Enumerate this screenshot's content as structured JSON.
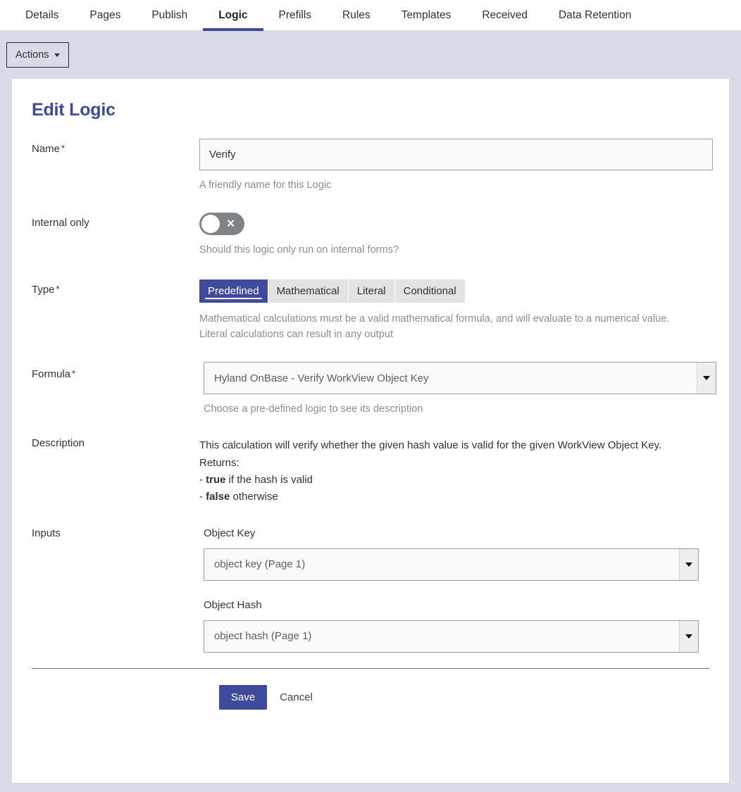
{
  "tabs": [
    {
      "label": "Details",
      "active": false
    },
    {
      "label": "Pages",
      "active": false
    },
    {
      "label": "Publish",
      "active": false
    },
    {
      "label": "Logic",
      "active": true
    },
    {
      "label": "Prefills",
      "active": false
    },
    {
      "label": "Rules",
      "active": false
    },
    {
      "label": "Templates",
      "active": false
    },
    {
      "label": "Received",
      "active": false
    },
    {
      "label": "Data Retention",
      "active": false
    }
  ],
  "toolbar": {
    "actions_label": "Actions"
  },
  "page": {
    "title": "Edit Logic"
  },
  "form": {
    "name": {
      "label": "Name",
      "required_mark": "*",
      "value": "Verify",
      "placeholder": "",
      "help": "A friendly name for this Logic"
    },
    "internal_only": {
      "label": "Internal only",
      "state": "off",
      "glyph": "✕",
      "help": "Should this logic only run on internal forms?"
    },
    "type": {
      "label": "Type",
      "required_mark": "*",
      "options": [
        "Predefined",
        "Mathematical",
        "Literal",
        "Conditional"
      ],
      "selected": "Predefined",
      "help_line1": "Mathematical calculations must be a valid mathematical formula, and will evaluate to a numerical value.",
      "help_line2": "Literal calculations can result in any output"
    },
    "formula": {
      "label": "Formula",
      "required_mark": "*",
      "value": "Hyland OnBase - Verify WorkView Object Key",
      "help": "Choose a pre-defined logic to see its description"
    },
    "description": {
      "label": "Description",
      "line1": "This calculation will verify whether the given hash value is valid for the given WorkView Object Key.",
      "line2": "Returns:",
      "line3_prefix": "- ",
      "line3_bold": "true",
      "line3_suffix": " if the hash is valid",
      "line4_prefix": "- ",
      "line4_bold": "false",
      "line4_suffix": " otherwise"
    },
    "inputs": {
      "label": "Inputs",
      "fields": [
        {
          "label": "Object Key",
          "value": "object key (Page 1)"
        },
        {
          "label": "Object Hash",
          "value": "object hash (Page 1)"
        }
      ]
    }
  },
  "footer": {
    "save_label": "Save",
    "cancel_label": "Cancel"
  },
  "colors": {
    "accent": "#3f4a9c",
    "bar_bg": "#d9dbe8",
    "toggle_off": "#808387",
    "segment_inactive": "#e2e2e2"
  }
}
